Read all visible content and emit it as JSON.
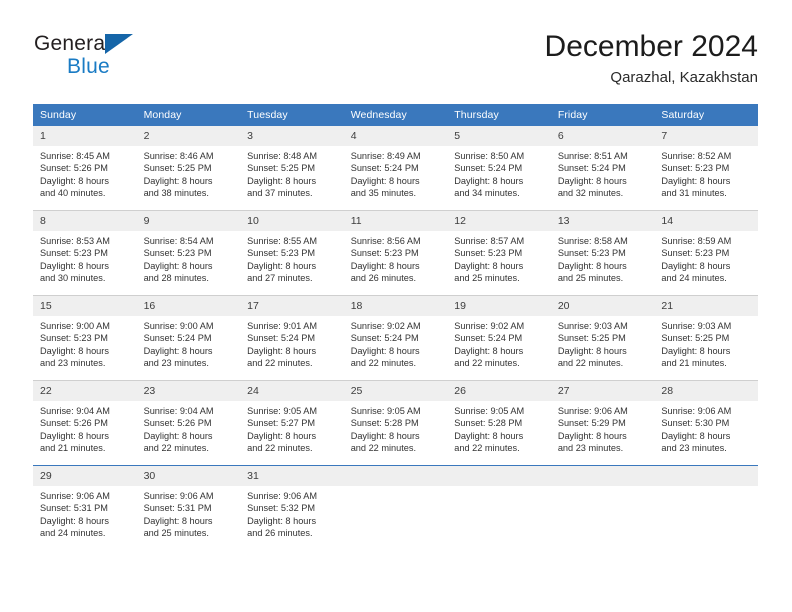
{
  "brand": {
    "name_top": "General",
    "name_bottom": "Blue",
    "triangle_color": "#1565a8",
    "blue_text_color": "#1a7bc4"
  },
  "header": {
    "title": "December 2024",
    "subtitle": "Qarazhal, Kazakhstan"
  },
  "theme": {
    "header_bg": "#3a78bd",
    "header_text": "#ffffff",
    "daynum_bg": "#efefef",
    "row_divider": "#cfcfcf",
    "accent_divider": "#3a78bd"
  },
  "calendar": {
    "weekday_headers": [
      "Sunday",
      "Monday",
      "Tuesday",
      "Wednesday",
      "Thursday",
      "Friday",
      "Saturday"
    ],
    "weeks": [
      [
        {
          "day": "1",
          "sunrise": "Sunrise: 8:45 AM",
          "sunset": "Sunset: 5:26 PM",
          "daylight_line1": "Daylight: 8 hours",
          "daylight_line2": "and 40 minutes."
        },
        {
          "day": "2",
          "sunrise": "Sunrise: 8:46 AM",
          "sunset": "Sunset: 5:25 PM",
          "daylight_line1": "Daylight: 8 hours",
          "daylight_line2": "and 38 minutes."
        },
        {
          "day": "3",
          "sunrise": "Sunrise: 8:48 AM",
          "sunset": "Sunset: 5:25 PM",
          "daylight_line1": "Daylight: 8 hours",
          "daylight_line2": "and 37 minutes."
        },
        {
          "day": "4",
          "sunrise": "Sunrise: 8:49 AM",
          "sunset": "Sunset: 5:24 PM",
          "daylight_line1": "Daylight: 8 hours",
          "daylight_line2": "and 35 minutes."
        },
        {
          "day": "5",
          "sunrise": "Sunrise: 8:50 AM",
          "sunset": "Sunset: 5:24 PM",
          "daylight_line1": "Daylight: 8 hours",
          "daylight_line2": "and 34 minutes."
        },
        {
          "day": "6",
          "sunrise": "Sunrise: 8:51 AM",
          "sunset": "Sunset: 5:24 PM",
          "daylight_line1": "Daylight: 8 hours",
          "daylight_line2": "and 32 minutes."
        },
        {
          "day": "7",
          "sunrise": "Sunrise: 8:52 AM",
          "sunset": "Sunset: 5:23 PM",
          "daylight_line1": "Daylight: 8 hours",
          "daylight_line2": "and 31 minutes."
        }
      ],
      [
        {
          "day": "8",
          "sunrise": "Sunrise: 8:53 AM",
          "sunset": "Sunset: 5:23 PM",
          "daylight_line1": "Daylight: 8 hours",
          "daylight_line2": "and 30 minutes."
        },
        {
          "day": "9",
          "sunrise": "Sunrise: 8:54 AM",
          "sunset": "Sunset: 5:23 PM",
          "daylight_line1": "Daylight: 8 hours",
          "daylight_line2": "and 28 minutes."
        },
        {
          "day": "10",
          "sunrise": "Sunrise: 8:55 AM",
          "sunset": "Sunset: 5:23 PM",
          "daylight_line1": "Daylight: 8 hours",
          "daylight_line2": "and 27 minutes."
        },
        {
          "day": "11",
          "sunrise": "Sunrise: 8:56 AM",
          "sunset": "Sunset: 5:23 PM",
          "daylight_line1": "Daylight: 8 hours",
          "daylight_line2": "and 26 minutes."
        },
        {
          "day": "12",
          "sunrise": "Sunrise: 8:57 AM",
          "sunset": "Sunset: 5:23 PM",
          "daylight_line1": "Daylight: 8 hours",
          "daylight_line2": "and 25 minutes."
        },
        {
          "day": "13",
          "sunrise": "Sunrise: 8:58 AM",
          "sunset": "Sunset: 5:23 PM",
          "daylight_line1": "Daylight: 8 hours",
          "daylight_line2": "and 25 minutes."
        },
        {
          "day": "14",
          "sunrise": "Sunrise: 8:59 AM",
          "sunset": "Sunset: 5:23 PM",
          "daylight_line1": "Daylight: 8 hours",
          "daylight_line2": "and 24 minutes."
        }
      ],
      [
        {
          "day": "15",
          "sunrise": "Sunrise: 9:00 AM",
          "sunset": "Sunset: 5:23 PM",
          "daylight_line1": "Daylight: 8 hours",
          "daylight_line2": "and 23 minutes."
        },
        {
          "day": "16",
          "sunrise": "Sunrise: 9:00 AM",
          "sunset": "Sunset: 5:24 PM",
          "daylight_line1": "Daylight: 8 hours",
          "daylight_line2": "and 23 minutes."
        },
        {
          "day": "17",
          "sunrise": "Sunrise: 9:01 AM",
          "sunset": "Sunset: 5:24 PM",
          "daylight_line1": "Daylight: 8 hours",
          "daylight_line2": "and 22 minutes."
        },
        {
          "day": "18",
          "sunrise": "Sunrise: 9:02 AM",
          "sunset": "Sunset: 5:24 PM",
          "daylight_line1": "Daylight: 8 hours",
          "daylight_line2": "and 22 minutes."
        },
        {
          "day": "19",
          "sunrise": "Sunrise: 9:02 AM",
          "sunset": "Sunset: 5:24 PM",
          "daylight_line1": "Daylight: 8 hours",
          "daylight_line2": "and 22 minutes."
        },
        {
          "day": "20",
          "sunrise": "Sunrise: 9:03 AM",
          "sunset": "Sunset: 5:25 PM",
          "daylight_line1": "Daylight: 8 hours",
          "daylight_line2": "and 22 minutes."
        },
        {
          "day": "21",
          "sunrise": "Sunrise: 9:03 AM",
          "sunset": "Sunset: 5:25 PM",
          "daylight_line1": "Daylight: 8 hours",
          "daylight_line2": "and 21 minutes."
        }
      ],
      [
        {
          "day": "22",
          "sunrise": "Sunrise: 9:04 AM",
          "sunset": "Sunset: 5:26 PM",
          "daylight_line1": "Daylight: 8 hours",
          "daylight_line2": "and 21 minutes."
        },
        {
          "day": "23",
          "sunrise": "Sunrise: 9:04 AM",
          "sunset": "Sunset: 5:26 PM",
          "daylight_line1": "Daylight: 8 hours",
          "daylight_line2": "and 22 minutes."
        },
        {
          "day": "24",
          "sunrise": "Sunrise: 9:05 AM",
          "sunset": "Sunset: 5:27 PM",
          "daylight_line1": "Daylight: 8 hours",
          "daylight_line2": "and 22 minutes."
        },
        {
          "day": "25",
          "sunrise": "Sunrise: 9:05 AM",
          "sunset": "Sunset: 5:28 PM",
          "daylight_line1": "Daylight: 8 hours",
          "daylight_line2": "and 22 minutes."
        },
        {
          "day": "26",
          "sunrise": "Sunrise: 9:05 AM",
          "sunset": "Sunset: 5:28 PM",
          "daylight_line1": "Daylight: 8 hours",
          "daylight_line2": "and 22 minutes."
        },
        {
          "day": "27",
          "sunrise": "Sunrise: 9:06 AM",
          "sunset": "Sunset: 5:29 PM",
          "daylight_line1": "Daylight: 8 hours",
          "daylight_line2": "and 23 minutes."
        },
        {
          "day": "28",
          "sunrise": "Sunrise: 9:06 AM",
          "sunset": "Sunset: 5:30 PM",
          "daylight_line1": "Daylight: 8 hours",
          "daylight_line2": "and 23 minutes."
        }
      ],
      [
        {
          "day": "29",
          "sunrise": "Sunrise: 9:06 AM",
          "sunset": "Sunset: 5:31 PM",
          "daylight_line1": "Daylight: 8 hours",
          "daylight_line2": "and 24 minutes."
        },
        {
          "day": "30",
          "sunrise": "Sunrise: 9:06 AM",
          "sunset": "Sunset: 5:31 PM",
          "daylight_line1": "Daylight: 8 hours",
          "daylight_line2": "and 25 minutes."
        },
        {
          "day": "31",
          "sunrise": "Sunrise: 9:06 AM",
          "sunset": "Sunset: 5:32 PM",
          "daylight_line1": "Daylight: 8 hours",
          "daylight_line2": "and 26 minutes."
        },
        {
          "day": "",
          "sunrise": "",
          "sunset": "",
          "daylight_line1": "",
          "daylight_line2": ""
        },
        {
          "day": "",
          "sunrise": "",
          "sunset": "",
          "daylight_line1": "",
          "daylight_line2": ""
        },
        {
          "day": "",
          "sunrise": "",
          "sunset": "",
          "daylight_line1": "",
          "daylight_line2": ""
        },
        {
          "day": "",
          "sunrise": "",
          "sunset": "",
          "daylight_line1": "",
          "daylight_line2": ""
        }
      ]
    ]
  }
}
